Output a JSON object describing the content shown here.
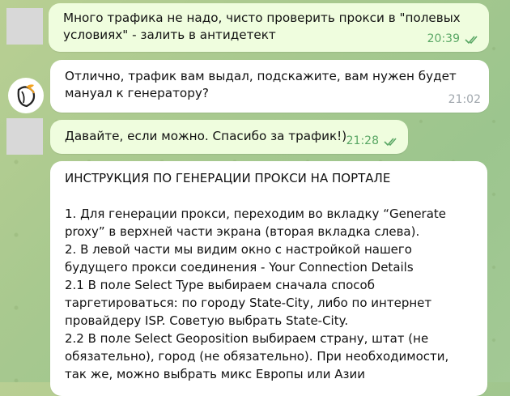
{
  "messages": [
    {
      "text": "Много трафика не надо, чисто проверить прокси в \"полевых условиях\" - залить в антидетект",
      "time": "20:39",
      "status_icon": "double-check-icon"
    },
    {
      "text": "Отлично, трафик вам выдал, подскажите, вам нужен будет мануал к генератору?",
      "time": "21:02"
    },
    {
      "text": "Давайте, если можно. Спасибо за трафик!)",
      "time": "21:28",
      "status_icon": "double-check-icon"
    },
    {
      "text": "ИНСТРУКЦИЯ ПО ГЕНЕРАЦИИ ПРОКСИ НА ПОРТАЛЕ\n\n1. Для генерации прокси, переходим во вкладку “Generate proxy” в верхней части экрана (вторая вкладка слева).\n2. В левой части мы видим окно с настройкой нашего будущего прокси соединения - Your Connection Details\n2.1 В поле Select Type выбираем сначала способ таргетироваться: по городу State-City, либо по интернет провайдеру ISP. Советую выбрать State-City.\n2.2 В поле Select Geoposition выбираем страну, штат (не обязательно), город (не обязательно). При необходимости, так же, можно выбрать микс Европы или Азии"
    }
  ],
  "colors": {
    "outgoing_bubble": "#effdde",
    "incoming_bubble": "#ffffff",
    "check": "#5aa765",
    "avatar_bg": "#d8d8d8"
  }
}
